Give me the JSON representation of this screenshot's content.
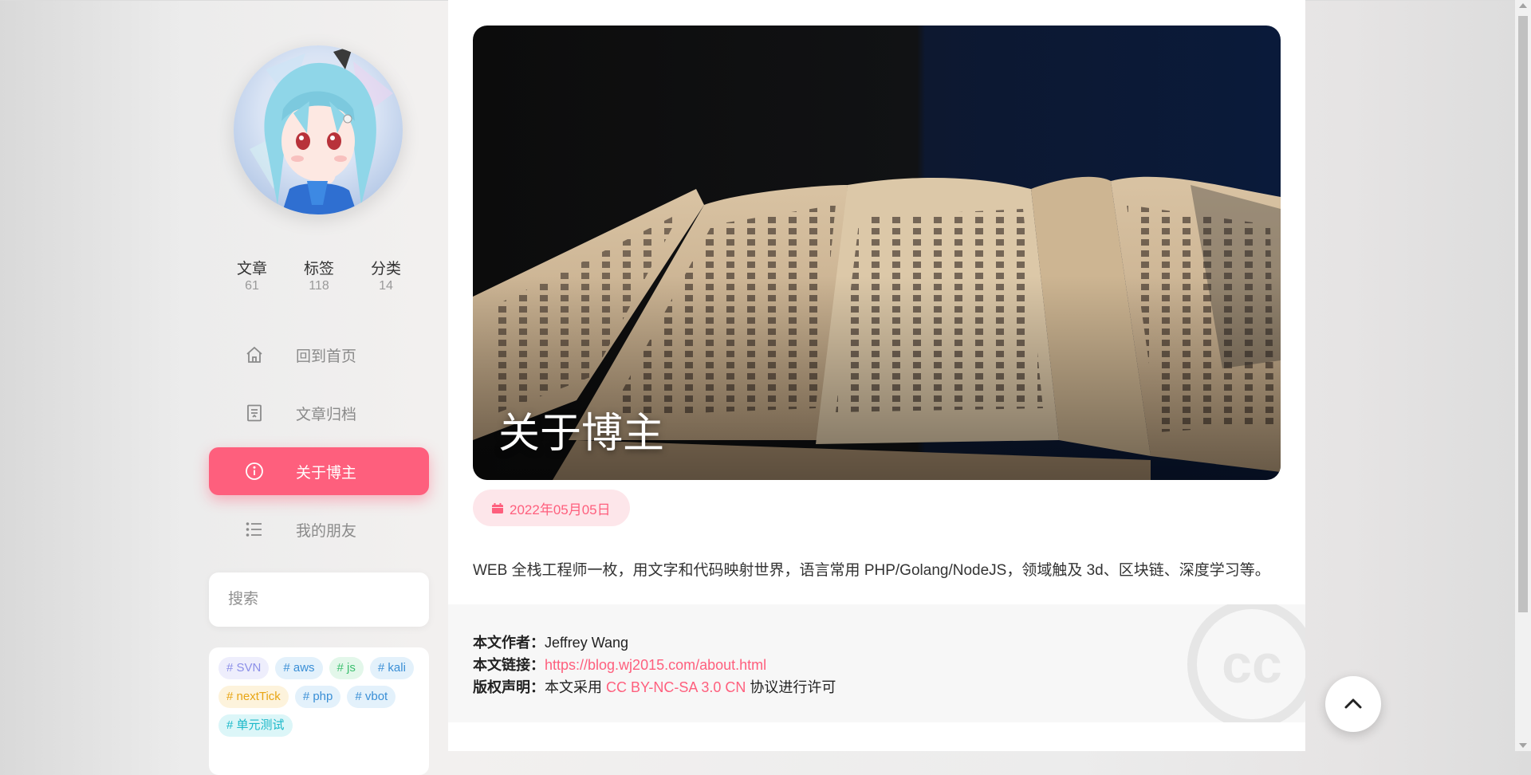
{
  "stats": [
    {
      "label": "文章",
      "value": "61"
    },
    {
      "label": "标签",
      "value": "118"
    },
    {
      "label": "分类",
      "value": "14"
    }
  ],
  "nav": [
    {
      "label": "回到首页",
      "icon": "home-icon"
    },
    {
      "label": "文章归档",
      "icon": "archive-icon"
    },
    {
      "label": "关于博主",
      "icon": "info-icon",
      "active": true
    },
    {
      "label": "我的朋友",
      "icon": "list-icon"
    }
  ],
  "search": {
    "placeholder": "搜索"
  },
  "tags": [
    {
      "label": "# SVN",
      "color": "#8b8fe8",
      "bg": "#eeeefc"
    },
    {
      "label": "# aws",
      "color": "#3a8fd6",
      "bg": "#e3f1fb"
    },
    {
      "label": "# js",
      "color": "#3bbf6e",
      "bg": "#e3f7ea"
    },
    {
      "label": "# kali",
      "color": "#3a8fd6",
      "bg": "#e3f1fb"
    },
    {
      "label": "# nextTick",
      "color": "#e8a514",
      "bg": "#fdf3dc"
    },
    {
      "label": "# php",
      "color": "#3a8fd6",
      "bg": "#e3f1fb"
    },
    {
      "label": "# vbot",
      "color": "#3a8fd6",
      "bg": "#e3f1fb"
    },
    {
      "label": "# 单元测试",
      "color": "#1ab8c9",
      "bg": "#dcf6f8"
    }
  ],
  "article": {
    "title": "关于博主",
    "date": "2022年05月05日",
    "intro": "WEB 全栈工程师一枚，用文字和代码映射世界，语言常用 PHP/Golang/NodeJS，领域触及 3d、区块链、深度学习等。"
  },
  "copyright": {
    "author_label": "本文作者：",
    "author": "Jeffrey Wang",
    "link_label": "本文链接：",
    "link": "https://blog.wj2015.com/about.html",
    "license_label": "版权声明：",
    "license_prefix": "本文采用 ",
    "license_name": "CC BY-NC-SA 3.0 CN",
    "license_suffix": " 协议进行许可"
  },
  "colors": {
    "accent": "#fe5f7d"
  }
}
